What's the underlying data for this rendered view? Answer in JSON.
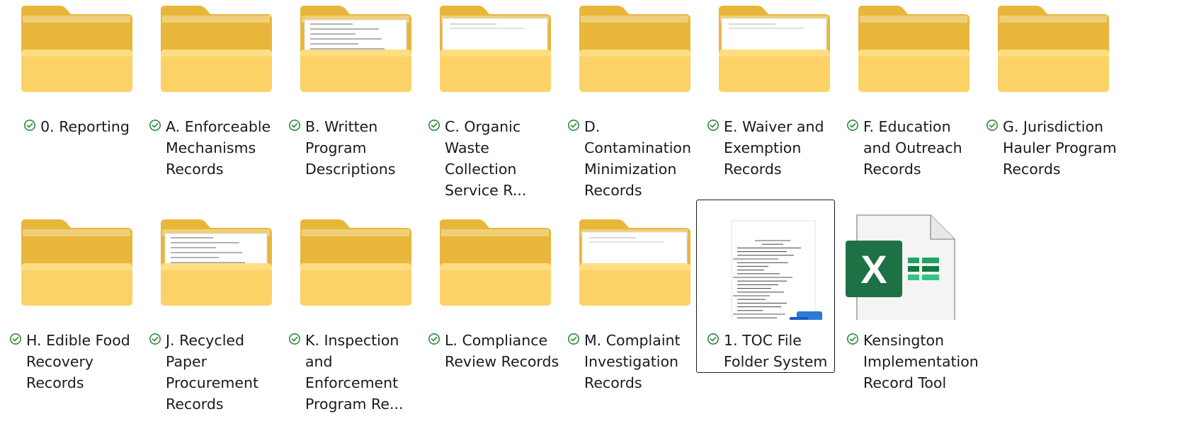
{
  "colors": {
    "folder_back": "#e8b63a",
    "folder_front": "#fcd166",
    "folder_front_top": "#ffe08a",
    "sync_green": "#2e8b3a",
    "excel_green": "#1e7145",
    "word_blue": "#185abd"
  },
  "items": [
    {
      "name": "0. Reporting",
      "type": "folder",
      "icon": "folder-icon"
    },
    {
      "name": "A. Enforceable Mechanisms Records",
      "type": "folder",
      "icon": "folder-icon"
    },
    {
      "name": "B. Written Program Descriptions",
      "type": "folder-with-docs",
      "icon": "folder-icon"
    },
    {
      "name": "C. Organic Waste Collection Service R...",
      "type": "folder-with-paper",
      "icon": "folder-icon"
    },
    {
      "name": "D. Contamination Minimization Records",
      "type": "folder",
      "icon": "folder-icon"
    },
    {
      "name": "E. Waiver and Exemption Records",
      "type": "folder-with-paper",
      "icon": "folder-icon"
    },
    {
      "name": "F. Education and Outreach Records",
      "type": "folder",
      "icon": "folder-icon"
    },
    {
      "name": "G. Jurisdiction Hauler Program Records",
      "type": "folder",
      "icon": "folder-icon"
    },
    {
      "name": "H. Edible Food Recovery Records",
      "type": "folder",
      "icon": "folder-icon"
    },
    {
      "name": "J. Recycled Paper Procurement Records",
      "type": "folder-with-docs",
      "icon": "folder-icon"
    },
    {
      "name": "K. Inspection and Enforcement Program Re...",
      "type": "folder",
      "icon": "folder-icon"
    },
    {
      "name": "L. Compliance Review Records",
      "type": "folder",
      "icon": "folder-icon"
    },
    {
      "name": "M. Complaint Investigation Records",
      "type": "folder-with-paper",
      "icon": "folder-icon"
    },
    {
      "name": "1. TOC File Folder System",
      "type": "word-doc",
      "icon": "word-icon",
      "selected": true
    },
    {
      "name": "Kensington Implementation Record Tool",
      "type": "excel",
      "icon": "excel-icon"
    }
  ]
}
